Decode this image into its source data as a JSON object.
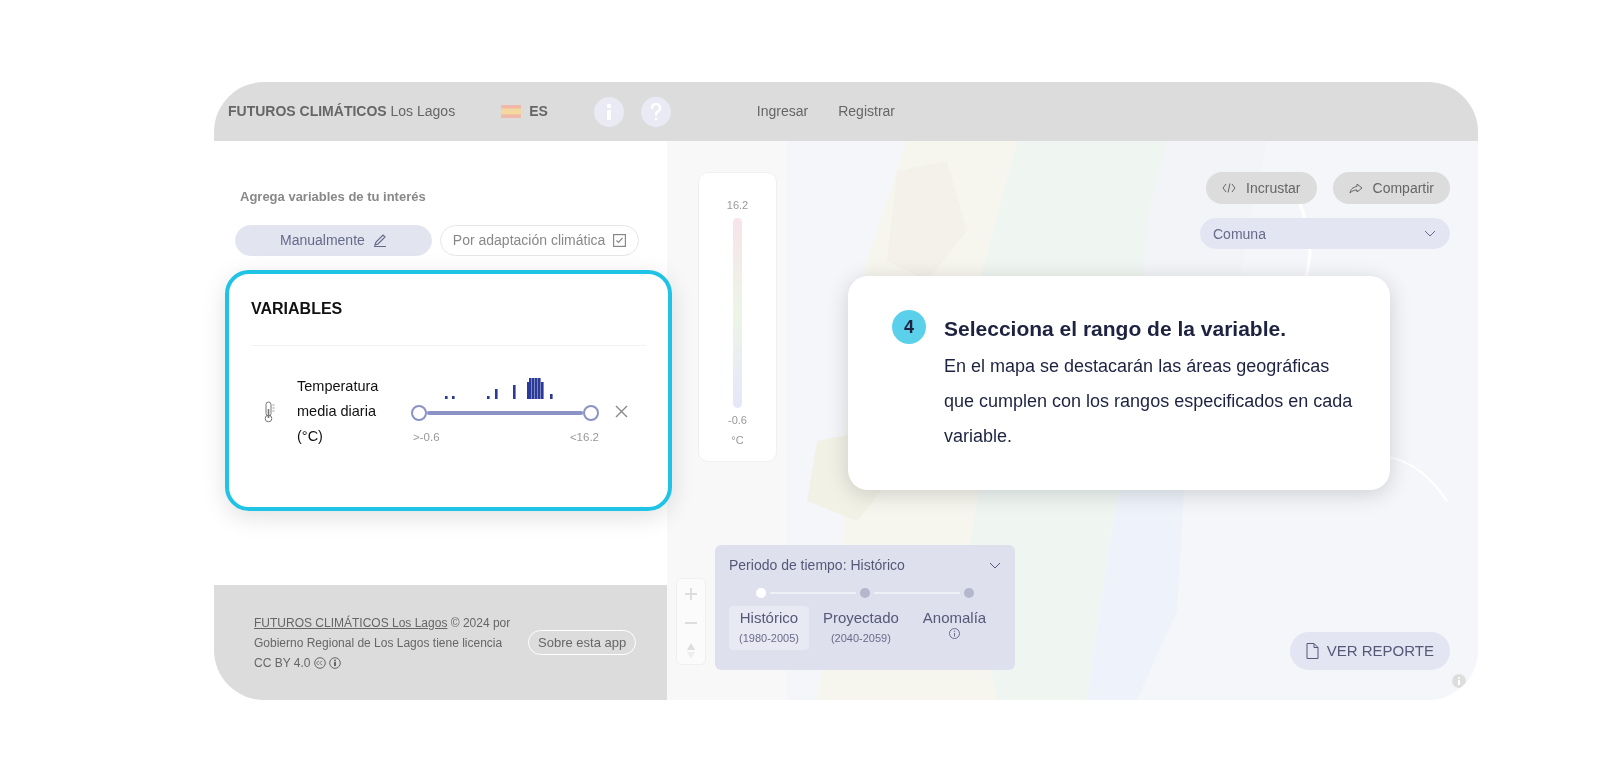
{
  "header": {
    "title": "**FUTUROS CLIMÁTICOS** Los Lagos",
    "language": "ES",
    "links": [
      "Ingresar",
      "Registrar"
    ]
  },
  "sidebar": {
    "prompt": "Agrega variables de tu interés",
    "modes": [
      {
        "label": "Manualmente",
        "kind": "pencil",
        "selected": true
      },
      {
        "label": "Por adaptación climática",
        "kind": "checkbox",
        "selected": false
      }
    ]
  },
  "variables_card": {
    "title": "VARIABLES",
    "variables": [
      {
        "name": "Temperatura media diaria (°C)",
        "level": 1,
        "min_label": ">-0.6",
        "max_label": "<16.2"
      }
    ]
  },
  "footer": {
    "link": "FUTUROS CLIMÁTICOS Los Lagos",
    "text": " © 2024 por Gobierno Regional de Los Lagos tiene licencia CC BY 4.0",
    "button": "Sobre esta app"
  },
  "legend": {
    "max": "16.2",
    "min": "-0.6",
    "unit": "°C"
  },
  "map_actions": [
    {
      "label": "Incrustar",
      "kind": "code"
    },
    {
      "label": "Compartir",
      "kind": "share"
    }
  ],
  "comuna_select": {
    "placeholder": "Comuna"
  },
  "period": {
    "title": "Periodo de tiempo: Histórico",
    "options": [
      {
        "label": "Histórico",
        "sub": "(1980-2005)",
        "selected": true
      },
      {
        "label": "Proyectado",
        "sub": "(2040-2059)",
        "selected": false
      },
      {
        "label": "Anomalía",
        "selected": false
      }
    ]
  },
  "report_button": "VER REPORTE",
  "tutorial": {
    "step": "4",
    "title": "Selecciona el rango de la variable.",
    "body": "En el mapa se destacarán las áreas geográficas que cumplen con los rangos especificados en cada variable."
  }
}
